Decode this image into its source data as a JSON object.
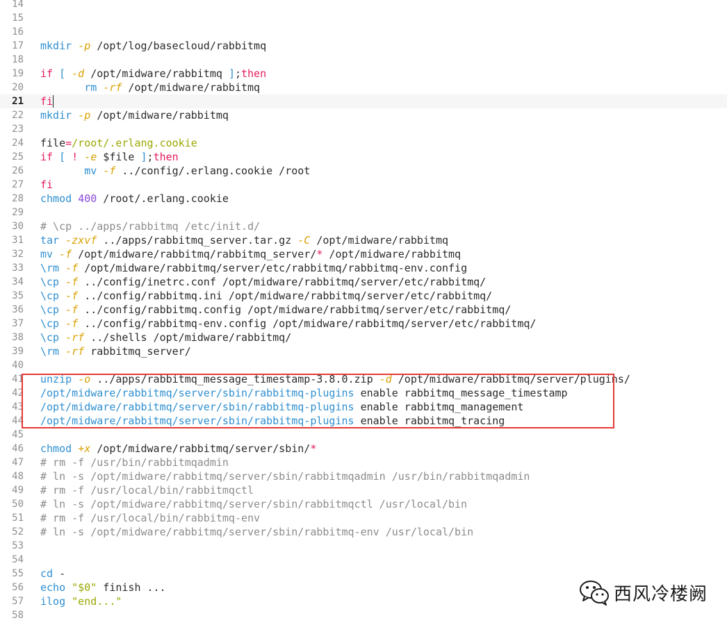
{
  "editor": {
    "current_line": 21,
    "lines": [
      {
        "n": "14",
        "tokens": []
      },
      {
        "n": "15",
        "tokens": []
      },
      {
        "n": "16",
        "tokens": []
      },
      {
        "n": "17",
        "tokens": [
          [
            "fn",
            "mkdir"
          ],
          [
            "plain",
            " "
          ],
          [
            "flag",
            "-p"
          ],
          [
            "plain",
            " /opt/log/basecloud/rabbitmq"
          ]
        ]
      },
      {
        "n": "18",
        "tokens": []
      },
      {
        "n": "19",
        "tokens": [
          [
            "kw",
            "if"
          ],
          [
            "plain",
            " "
          ],
          [
            "fn",
            "["
          ],
          [
            "plain",
            " "
          ],
          [
            "flag",
            "-d"
          ],
          [
            "plain",
            " /opt/midware/rabbitmq "
          ],
          [
            "fn",
            "]"
          ],
          [
            "plain",
            ";"
          ],
          [
            "kw",
            "then"
          ]
        ]
      },
      {
        "n": "20",
        "tokens": [
          [
            "plain",
            "       "
          ],
          [
            "fn",
            "rm"
          ],
          [
            "plain",
            " "
          ],
          [
            "flag",
            "-rf"
          ],
          [
            "plain",
            " /opt/midware/rabbitmq"
          ]
        ]
      },
      {
        "n": "21",
        "tokens": [
          [
            "kw",
            "fi"
          ]
        ]
      },
      {
        "n": "22",
        "tokens": [
          [
            "fn",
            "mkdir"
          ],
          [
            "plain",
            " "
          ],
          [
            "flag",
            "-p"
          ],
          [
            "plain",
            " /opt/midware/rabbitmq"
          ]
        ]
      },
      {
        "n": "23",
        "tokens": []
      },
      {
        "n": "24",
        "tokens": [
          [
            "plain",
            "file"
          ],
          [
            "kw",
            "="
          ],
          [
            "str",
            "/root/.erlang.cookie"
          ]
        ]
      },
      {
        "n": "25",
        "tokens": [
          [
            "kw",
            "if"
          ],
          [
            "plain",
            " "
          ],
          [
            "fn",
            "["
          ],
          [
            "plain",
            " "
          ],
          [
            "kw",
            "!"
          ],
          [
            "plain",
            " "
          ],
          [
            "flag",
            "-e"
          ],
          [
            "plain",
            " $file "
          ],
          [
            "fn",
            "]"
          ],
          [
            "plain",
            ";"
          ],
          [
            "kw",
            "then"
          ]
        ]
      },
      {
        "n": "26",
        "tokens": [
          [
            "plain",
            "       "
          ],
          [
            "fn",
            "mv"
          ],
          [
            "plain",
            " "
          ],
          [
            "flag",
            "-f"
          ],
          [
            "plain",
            " ../config/.erlang.cookie /root"
          ]
        ]
      },
      {
        "n": "27",
        "tokens": [
          [
            "kw",
            "fi"
          ]
        ]
      },
      {
        "n": "28",
        "tokens": [
          [
            "fn",
            "chmod"
          ],
          [
            "plain",
            " "
          ],
          [
            "num",
            "400"
          ],
          [
            "plain",
            " /root/.erlang.cookie"
          ]
        ]
      },
      {
        "n": "29",
        "tokens": []
      },
      {
        "n": "30",
        "tokens": [
          [
            "cm",
            "# \\cp ../apps/rabbitmq /etc/init.d/"
          ]
        ]
      },
      {
        "n": "31",
        "tokens": [
          [
            "fn",
            "tar"
          ],
          [
            "plain",
            " "
          ],
          [
            "flag",
            "-zxvf"
          ],
          [
            "plain",
            " ../apps/rabbitmq_server.tar.gz "
          ],
          [
            "flag",
            "-C"
          ],
          [
            "plain",
            " /opt/midware/rabbitmq"
          ]
        ]
      },
      {
        "n": "32",
        "tokens": [
          [
            "fn",
            "mv"
          ],
          [
            "plain",
            " "
          ],
          [
            "flag",
            "-f"
          ],
          [
            "plain",
            " /opt/midware/rabbitmq/rabbitmq_server/"
          ],
          [
            "kw",
            "*"
          ],
          [
            "plain",
            " /opt/midware/rabbitmq"
          ]
        ]
      },
      {
        "n": "33",
        "tokens": [
          [
            "fn",
            "\\rm"
          ],
          [
            "plain",
            " "
          ],
          [
            "flag",
            "-f"
          ],
          [
            "plain",
            " /opt/midware/rabbitmq/server/etc/rabbitmq/rabbitmq-env.config"
          ]
        ]
      },
      {
        "n": "34",
        "tokens": [
          [
            "fn",
            "\\cp"
          ],
          [
            "plain",
            " "
          ],
          [
            "flag",
            "-f"
          ],
          [
            "plain",
            " ../config/inetrc.conf /opt/midware/rabbitmq/server/etc/rabbitmq/"
          ]
        ]
      },
      {
        "n": "35",
        "tokens": [
          [
            "fn",
            "\\cp"
          ],
          [
            "plain",
            " "
          ],
          [
            "flag",
            "-f"
          ],
          [
            "plain",
            " ../config/rabbitmq.ini /opt/midware/rabbitmq/server/etc/rabbitmq/"
          ]
        ]
      },
      {
        "n": "36",
        "tokens": [
          [
            "fn",
            "\\cp"
          ],
          [
            "plain",
            " "
          ],
          [
            "flag",
            "-f"
          ],
          [
            "plain",
            " ../config/rabbitmq.config /opt/midware/rabbitmq/server/etc/rabbitmq/"
          ]
        ]
      },
      {
        "n": "37",
        "tokens": [
          [
            "fn",
            "\\cp"
          ],
          [
            "plain",
            " "
          ],
          [
            "flag",
            "-f"
          ],
          [
            "plain",
            " ../config/rabbitmq-env.config /opt/midware/rabbitmq/server/etc/rabbitmq/"
          ]
        ]
      },
      {
        "n": "38",
        "tokens": [
          [
            "fn",
            "\\cp"
          ],
          [
            "plain",
            " "
          ],
          [
            "flag",
            "-rf"
          ],
          [
            "plain",
            " ../shells /opt/midware/rabbitmq/"
          ]
        ]
      },
      {
        "n": "39",
        "tokens": [
          [
            "fn",
            "\\rm"
          ],
          [
            "plain",
            " "
          ],
          [
            "flag",
            "-rf"
          ],
          [
            "plain",
            " rabbitmq_server/"
          ]
        ]
      },
      {
        "n": "40",
        "tokens": []
      },
      {
        "n": "41",
        "tokens": [
          [
            "fn",
            "unzip"
          ],
          [
            "plain",
            " "
          ],
          [
            "flag",
            "-o"
          ],
          [
            "plain",
            " ../apps/rabbitmq_message_timestamp-3.8.0.zip "
          ],
          [
            "flag",
            "-d"
          ],
          [
            "plain",
            " /opt/midware/rabbitmq/server/plugins/"
          ]
        ]
      },
      {
        "n": "42",
        "tokens": [
          [
            "fn",
            "/opt/midware/rabbitmq/server/sbin/rabbitmq-plugins"
          ],
          [
            "plain",
            " enable rabbitmq_message_timestamp"
          ]
        ]
      },
      {
        "n": "43",
        "tokens": [
          [
            "fn",
            "/opt/midware/rabbitmq/server/sbin/rabbitmq-plugins"
          ],
          [
            "plain",
            " enable rabbitmq_management"
          ]
        ]
      },
      {
        "n": "44",
        "tokens": [
          [
            "fn",
            "/opt/midware/rabbitmq/server/sbin/rabbitmq-plugins"
          ],
          [
            "plain",
            " enable rabbitmq_tracing"
          ]
        ]
      },
      {
        "n": "45",
        "tokens": []
      },
      {
        "n": "46",
        "tokens": [
          [
            "fn",
            "chmod"
          ],
          [
            "plain",
            " "
          ],
          [
            "flag",
            "+x"
          ],
          [
            "plain",
            " /opt/midware/rabbitmq/server/sbin/"
          ],
          [
            "kw",
            "*"
          ]
        ]
      },
      {
        "n": "47",
        "tokens": [
          [
            "cm",
            "# rm -f /usr/bin/rabbitmqadmin"
          ]
        ]
      },
      {
        "n": "48",
        "tokens": [
          [
            "cm",
            "# ln -s /opt/midware/rabbitmq/server/sbin/rabbitmqadmin /usr/bin/rabbitmqadmin"
          ]
        ]
      },
      {
        "n": "49",
        "tokens": [
          [
            "cm",
            "# rm -f /usr/local/bin/rabbitmqctl"
          ]
        ]
      },
      {
        "n": "50",
        "tokens": [
          [
            "cm",
            "# ln -s /opt/midware/rabbitmq/server/sbin/rabbitmqctl /usr/local/bin"
          ]
        ]
      },
      {
        "n": "51",
        "tokens": [
          [
            "cm",
            "# rm -f /usr/local/bin/rabbitmq-env"
          ]
        ]
      },
      {
        "n": "52",
        "tokens": [
          [
            "cm",
            "# ln -s /opt/midware/rabbitmq/server/sbin/rabbitmq-env /usr/local/bin"
          ]
        ]
      },
      {
        "n": "53",
        "tokens": []
      },
      {
        "n": "54",
        "tokens": []
      },
      {
        "n": "55",
        "tokens": [
          [
            "fn",
            "cd"
          ],
          [
            "plain",
            " -"
          ]
        ]
      },
      {
        "n": "56",
        "tokens": [
          [
            "fn",
            "echo"
          ],
          [
            "plain",
            " "
          ],
          [
            "str",
            "\"$0\""
          ],
          [
            "plain",
            " finish ..."
          ]
        ]
      },
      {
        "n": "57",
        "tokens": [
          [
            "fn",
            "ilog"
          ],
          [
            "plain",
            " "
          ],
          [
            "str",
            "\"end...\""
          ]
        ]
      },
      {
        "n": "58",
        "tokens": []
      }
    ]
  },
  "watermark": {
    "text": "西风冷楼阙",
    "icon": "wechat-icon",
    "color": "#1a1a1a"
  },
  "highlight": {
    "color": "#e53935"
  }
}
